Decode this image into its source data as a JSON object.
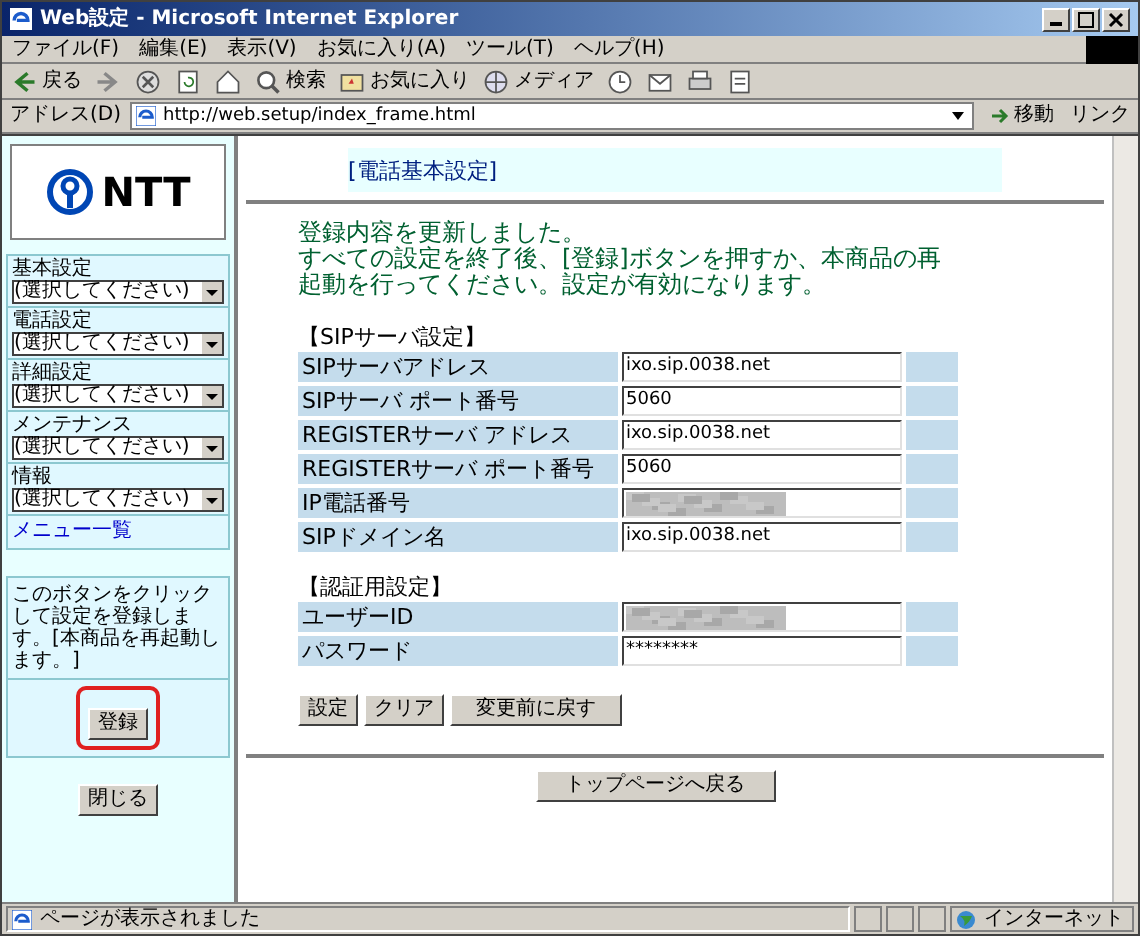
{
  "window": {
    "title": "Web設定 - Microsoft Internet Explorer"
  },
  "menu": [
    "ファイル(F)",
    "編集(E)",
    "表示(V)",
    "お気に入り(A)",
    "ツール(T)",
    "ヘルプ(H)"
  ],
  "toolbar": [
    {
      "kind": "back",
      "label": "戻る"
    },
    {
      "kind": "forward"
    },
    {
      "kind": "stop"
    },
    {
      "kind": "refresh"
    },
    {
      "kind": "home"
    },
    {
      "kind": "search",
      "label": "検索"
    },
    {
      "kind": "favorites",
      "label": "お気に入り"
    },
    {
      "kind": "media",
      "label": "メディア"
    },
    {
      "kind": "history"
    },
    {
      "kind": "mail"
    },
    {
      "kind": "print"
    },
    {
      "kind": "edit"
    }
  ],
  "address": {
    "label": "アドレス(D)",
    "url": "http://web.setup/index_frame.html",
    "go": "移動",
    "links": "リンク"
  },
  "sidebar": {
    "logo": "NTT",
    "menus": [
      {
        "label": "基本設定",
        "value": "(選択してください)"
      },
      {
        "label": "電話設定",
        "value": "(選択してください)"
      },
      {
        "label": "詳細設定",
        "value": "(選択してください)"
      },
      {
        "label": "メンテナンス",
        "value": "(選択してください)"
      },
      {
        "label": "情報",
        "value": "(選択してください)"
      }
    ],
    "menu_list_link": "メニュー一覧",
    "register_note": "このボタンをクリックして設定を登録します。[本商品を再起動します。]",
    "register_button": "登録",
    "close_button": "閉じる"
  },
  "main": {
    "heading": "[電話基本設定]",
    "message": [
      "登録内容を更新しました。",
      "すべての設定を終了後、[登録]ボタンを押すか、本商品の再",
      "起動を行ってください。設定が有効になります。"
    ],
    "sections": [
      {
        "title": "【SIPサーバ設定】",
        "rows": [
          {
            "label": "SIPサーバアドレス",
            "kind": "text",
            "value": "ixo.sip.0038.net"
          },
          {
            "label": "SIPサーバ ポート番号",
            "kind": "text",
            "value": "5060"
          },
          {
            "label": "REGISTERサーバ アドレス",
            "kind": "text",
            "value": "ixo.sip.0038.net"
          },
          {
            "label": "REGISTERサーバ ポート番号",
            "kind": "text",
            "value": "5060"
          },
          {
            "label": "IP電話番号",
            "kind": "masked"
          },
          {
            "label": "SIPドメイン名",
            "kind": "text",
            "value": "ixo.sip.0038.net"
          }
        ]
      },
      {
        "title": "【認証用設定】",
        "rows": [
          {
            "label": "ユーザーID",
            "kind": "masked"
          },
          {
            "label": "パスワード",
            "kind": "text",
            "value": "********"
          }
        ]
      }
    ],
    "buttons": [
      "設定",
      "クリア",
      "変更前に戻す"
    ],
    "top_button": "トップページへ戻る"
  },
  "status_bar": {
    "text": "ページが表示されました",
    "zone": "インターネット"
  }
}
